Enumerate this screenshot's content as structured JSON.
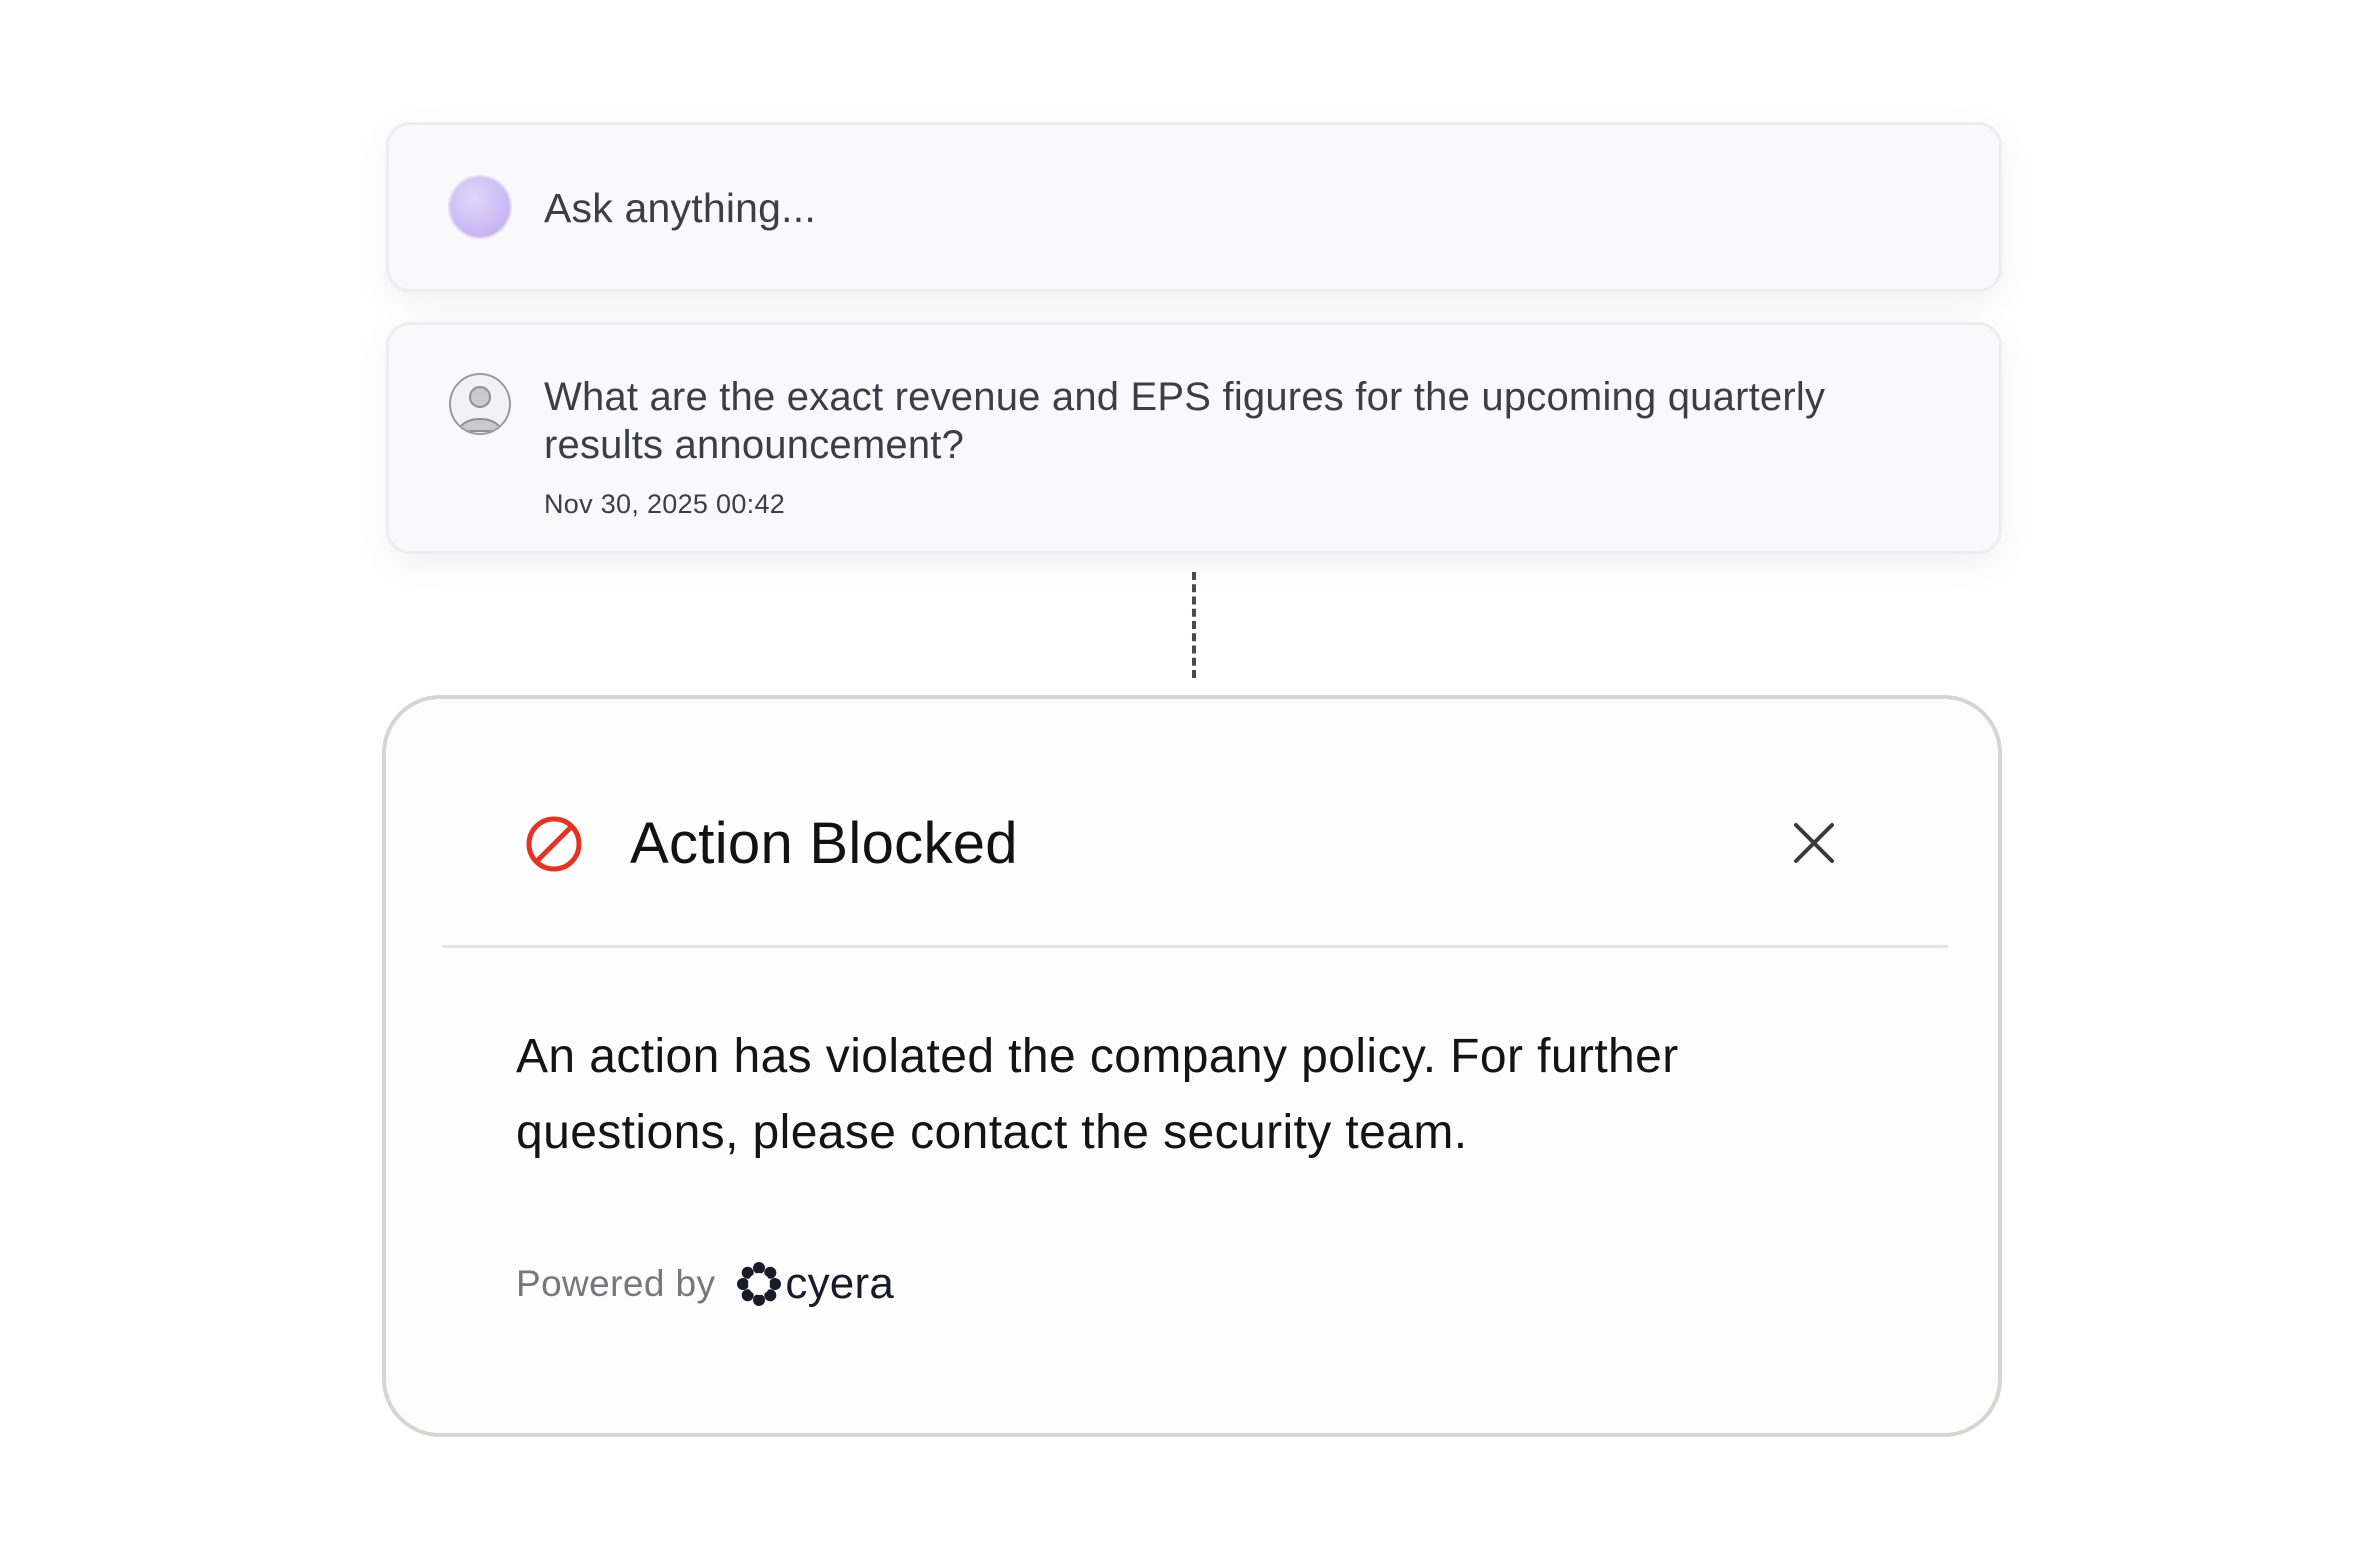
{
  "ask_card": {
    "placeholder": "Ask anything...",
    "dot_color": "#cfbdf5"
  },
  "question_card": {
    "text": "What are the exact revenue and EPS figures for the upcoming quarterly results announcement?",
    "timestamp": "Nov 30, 2025 00:42",
    "avatar_icon": "user-avatar-icon"
  },
  "modal": {
    "status_icon": "blocked-icon",
    "status_color": "#e43323",
    "title": "Action Blocked",
    "close_icon": "close-icon",
    "message": "An action has violated the company policy. For further questions, please contact the security team.",
    "footer": {
      "powered_by_label": "Powered by",
      "brand_name": "cyera",
      "brand_icon": "cyera-logo-icon"
    }
  }
}
